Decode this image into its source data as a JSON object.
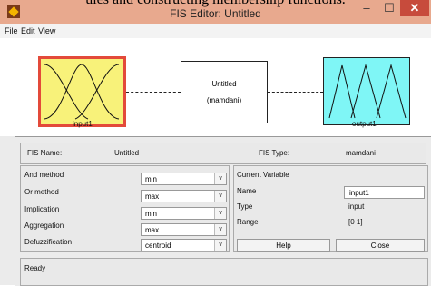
{
  "caption": {
    "text": "ules and constructing membership functions."
  },
  "window": {
    "title": "FIS Editor: Untitled",
    "min_symbol": "–",
    "max_symbol": "☐",
    "close_symbol": "✕"
  },
  "menu": {
    "items": [
      "File",
      "Edit",
      "View"
    ]
  },
  "diagram": {
    "input_label": "input1",
    "system_name": "Untitled",
    "system_type": "(mamdani)",
    "output_label": "output1",
    "colors": {
      "input_fill": "#f8f27a",
      "input_border": "#e34a3a",
      "output_fill": "#7ff6f6"
    }
  },
  "info": {
    "fis_name_label": "FIS Name:",
    "fis_name_value": "Untitled",
    "fis_type_label": "FIS Type:",
    "fis_type_value": "mamdani"
  },
  "methods": [
    {
      "label": "And method",
      "value": "min"
    },
    {
      "label": "Or method",
      "value": "max"
    },
    {
      "label": "Implication",
      "value": "min"
    },
    {
      "label": "Aggregation",
      "value": "max"
    },
    {
      "label": "Defuzzification",
      "value": "centroid"
    }
  ],
  "current_variable": {
    "heading": "Current Variable",
    "name_label": "Name",
    "name_value": "input1",
    "type_label": "Type",
    "type_value": "input",
    "range_label": "Range",
    "range_value": "[0 1]"
  },
  "buttons": {
    "help": "Help",
    "close": "Close"
  },
  "status": "Ready"
}
